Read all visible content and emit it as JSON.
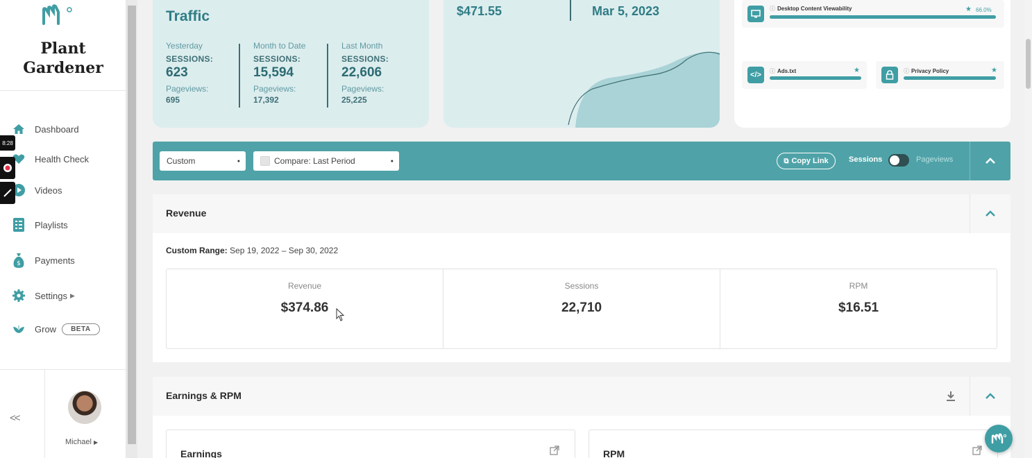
{
  "brand": {
    "name_line1": "Plant",
    "name_line2": "Gardener",
    "accent": "#3f9ea4"
  },
  "sidebar": {
    "items": [
      {
        "label": "Dashboard",
        "icon": "home-icon"
      },
      {
        "label": "Health Check",
        "icon": "heart-icon"
      },
      {
        "label": "Videos",
        "icon": "play-icon"
      },
      {
        "label": "Playlists",
        "icon": "list-icon"
      },
      {
        "label": "Payments",
        "icon": "money-bag-icon"
      },
      {
        "label": "Settings",
        "icon": "gear-icon"
      },
      {
        "label": "Grow",
        "icon": "leaf-icon",
        "badge": "BETA"
      }
    ],
    "collapse_label": "<<",
    "user_name": "Michael"
  },
  "overlay": {
    "timer": "8:28"
  },
  "traffic": {
    "title": "Traffic",
    "columns": [
      {
        "label": "Yesterday",
        "sessions_label": "SESSIONS:",
        "sessions": "623",
        "pageviews_label": "Pageviews:",
        "pageviews": "695"
      },
      {
        "label": "Month to Date",
        "sessions_label": "SESSIONS:",
        "sessions": "15,594",
        "pageviews_label": "Pageviews:",
        "pageviews": "17,392"
      },
      {
        "label": "Last Month",
        "sessions_label": "SESSIONS:",
        "sessions": "22,606",
        "pageviews_label": "Pageviews:",
        "pageviews": "25,225"
      }
    ]
  },
  "earnings_card": {
    "amount": "$471.55",
    "date": "Mar 5, 2023"
  },
  "health": {
    "items": [
      {
        "label": "Desktop Content Viewability",
        "icon": "monitor-icon",
        "value": "66.0%",
        "progress": 1.0
      },
      {
        "label": "Ads.txt",
        "icon": "code-icon",
        "progress": 1.0
      },
      {
        "label": "Privacy Policy",
        "icon": "lock-icon",
        "progress": 1.0
      }
    ]
  },
  "filterbar": {
    "range_select": "Custom",
    "compare_select": "Compare: Last Period",
    "copy_link": "Copy Link",
    "toggle_left": "Sessions",
    "toggle_right": "Pageviews"
  },
  "revenue": {
    "title": "Revenue",
    "range_label": "Custom Range:",
    "range_value": "Sep 19, 2022 – Sep 30, 2022",
    "metrics": [
      {
        "label": "Revenue",
        "value": "$374.86"
      },
      {
        "label": "Sessions",
        "value": "22,710"
      },
      {
        "label": "RPM",
        "value": "$16.51"
      }
    ]
  },
  "earnings_rpm": {
    "title": "Earnings & RPM",
    "cards": [
      {
        "title": "Earnings"
      },
      {
        "title": "RPM"
      }
    ]
  }
}
